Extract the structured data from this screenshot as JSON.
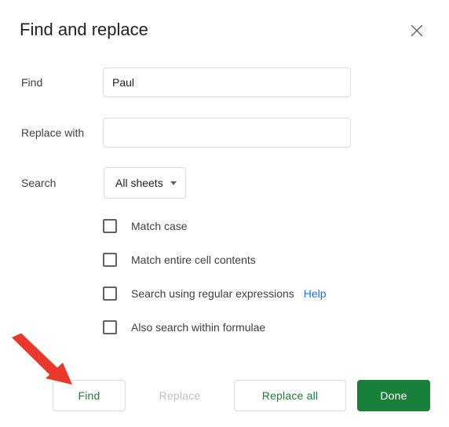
{
  "dialog": {
    "title": "Find and replace",
    "close_icon": "close-icon"
  },
  "fields": {
    "find": {
      "label": "Find",
      "value": "Paul",
      "placeholder": ""
    },
    "replace_with": {
      "label": "Replace with",
      "value": "",
      "placeholder": ""
    },
    "search": {
      "label": "Search",
      "selected": "All sheets",
      "caret_icon": "chevron-down-icon"
    }
  },
  "options": [
    {
      "label": "Match case",
      "checked": false
    },
    {
      "label": "Match entire cell contents",
      "checked": false
    },
    {
      "label": "Search using regular expressions",
      "checked": false,
      "link": "Help"
    },
    {
      "label": "Also search within formulae",
      "checked": false
    }
  ],
  "footer": {
    "find_label": "Find",
    "replace_label": "Replace",
    "replace_all_label": "Replace all",
    "done_label": "Done"
  },
  "annotation": {
    "type": "arrow",
    "points_to": "Find",
    "color": "#e8392c"
  },
  "colors": {
    "accent_green": "#188038",
    "link_blue": "#1a73e8",
    "text_primary": "#202124",
    "text_secondary": "#3c4043",
    "disabled": "#bdc1c6",
    "border": "#dadce0",
    "annotation_red": "#e8392c"
  }
}
